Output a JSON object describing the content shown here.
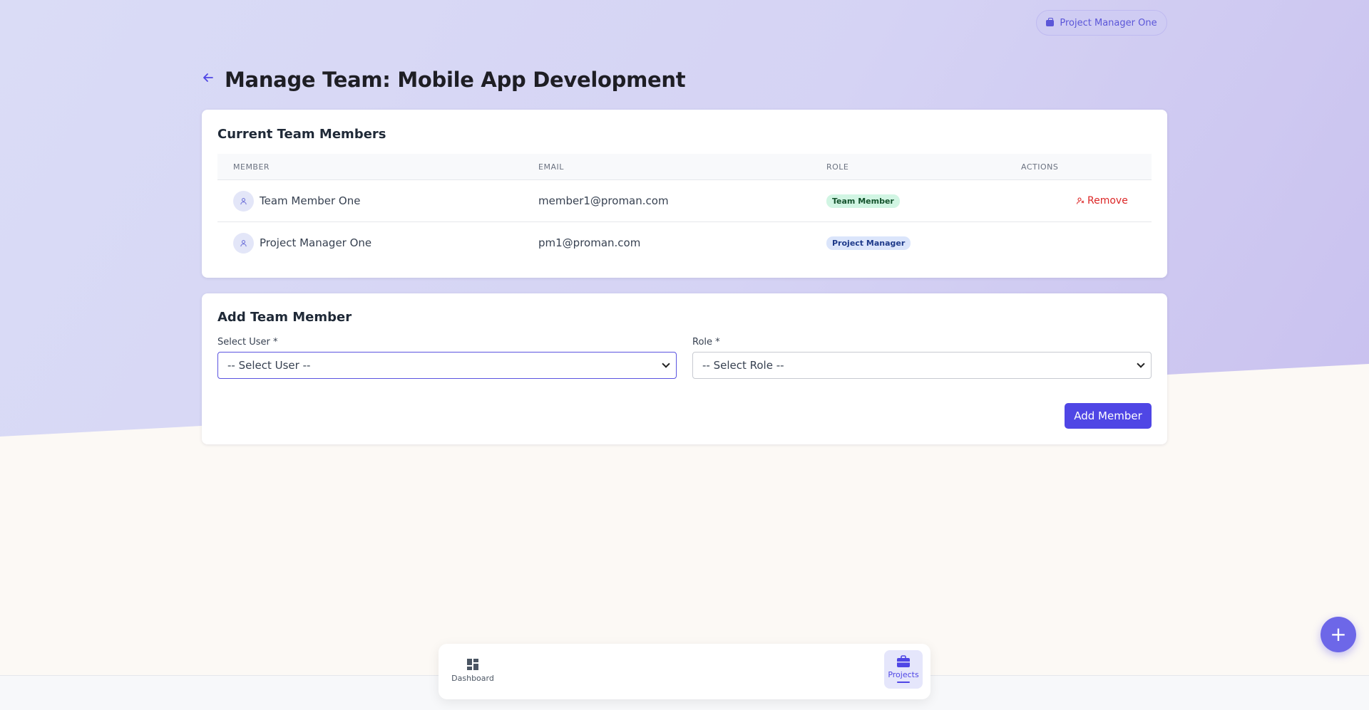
{
  "header": {
    "user_chip_label": "Project Manager One",
    "page_title": "Manage Team: Mobile App Development"
  },
  "members_card": {
    "title": "Current Team Members",
    "columns": [
      "MEMBER",
      "EMAIL",
      "ROLE",
      "ACTIONS"
    ],
    "rows": [
      {
        "name": "Team Member One",
        "email": "member1@proman.com",
        "role": "Team Member",
        "action": "Remove"
      },
      {
        "name": "Project Manager One",
        "email": "pm1@proman.com",
        "role": "Project Manager",
        "action": ""
      }
    ]
  },
  "add_card": {
    "title": "Add Team Member",
    "user_label": "Select User *",
    "user_value": "-- Select User --",
    "role_label": "Role *",
    "role_value": "-- Select Role --",
    "submit_label": "Add Member"
  },
  "bottom_nav": {
    "items": [
      {
        "label": "Dashboard",
        "icon": "grid-icon"
      },
      {
        "label": "Projects",
        "icon": "briefcase-icon"
      }
    ]
  },
  "fab": {
    "label": "+"
  },
  "colors": {
    "accent": "#4f46e5",
    "danger": "#dc2626"
  }
}
